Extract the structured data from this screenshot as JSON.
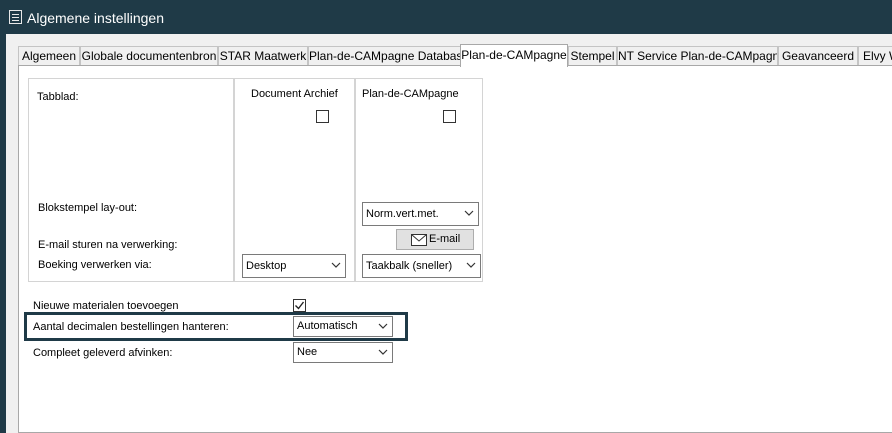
{
  "window": {
    "title": "Algemene instellingen"
  },
  "tabs": [
    {
      "label": "Algemeen",
      "active": false
    },
    {
      "label": "Globale documentenbron",
      "active": false
    },
    {
      "label": "STAR Maatwerk",
      "active": false
    },
    {
      "label": "Plan-de-CAMpagne Database",
      "active": false
    },
    {
      "label": "Plan-de-CAMpagne",
      "active": true
    },
    {
      "label": "Stempel",
      "active": false
    },
    {
      "label": "NT Service Plan-de-CAMpagne",
      "active": false
    },
    {
      "label": "Geavanceerd",
      "active": false
    },
    {
      "label": "Elvy We",
      "active": false
    }
  ],
  "grid": {
    "labels": {
      "tabblad": "Tabblad:",
      "blokstempel": "Blokstempel lay-out:",
      "email_sturen": "E-mail sturen na verwerking:",
      "boeking": "Boeking verwerken via:"
    },
    "document_archief": {
      "header": "Document Archief",
      "tab_checked": false,
      "boeking_value": "Desktop"
    },
    "plan_de_campagne": {
      "header": "Plan-de-CAMpagne",
      "tab_checked": false,
      "layout_value": "Norm.vert.met.",
      "email_button": "E-mail",
      "boeking_value": "Taakbalk (sneller)"
    }
  },
  "options": {
    "nieuwe_materialen": {
      "label": "Nieuwe materialen toevoegen",
      "checked": true
    },
    "aantal_decimalen": {
      "label": "Aantal decimalen bestellingen hanteren:",
      "value": "Automatisch"
    },
    "compleet_geleverd": {
      "label": "Compleet geleverd afvinken:",
      "value": "Nee"
    }
  },
  "icons": {
    "app": "app-window-icon",
    "dropdown": "chevron-down-icon",
    "mail": "envelope-icon",
    "check": "checkmark-icon"
  },
  "colors": {
    "titlebar": "#1f3a47",
    "highlight_border": "#1f3a47",
    "dialog_bg": "#f0f0f0"
  }
}
